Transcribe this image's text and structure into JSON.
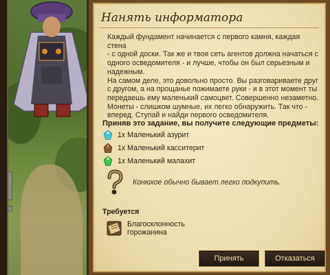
{
  "quest": {
    "title": "Нанять информатора",
    "description_lines": [
      "Каждый фундамент начинается с первого камня, каждая стена",
      "- с одной доски. Так же и твоя сеть агентов должна начаться с",
      "одного осведомителя - и лучше, чтобы он был серьезным и",
      "надежным.",
      "На самом деле, это довольно просто. Вы разговариваете друг",
      "с другом, а на прощанье пожимаете руки - и в этот момент ты",
      "передаешь ему маленький самоцвет. Совершенно незаметно.",
      "Монеты - слишком шумные, их легко обнаружить. Так что -",
      "вперед. Ступай и найди первого осведомителя."
    ],
    "rewards_heading": "Приняв это задание, вы получите следующие предметы:",
    "rewards": [
      {
        "text": "1x Маленький азурит",
        "icon": "azurite-gem-icon",
        "color": "#4fc6d8"
      },
      {
        "text": "1x Маленький касситерит",
        "icon": "cassiterite-gem-icon",
        "color": "#8a5a32"
      },
      {
        "text": "1x Маленький малахит",
        "icon": "malachite-gem-icon",
        "color": "#3ec64a"
      }
    ],
    "hint": "Конюхое обычно бывает легко подкупить.",
    "requires_heading": "Требуется",
    "requirement": {
      "line1": "Благосклонность",
      "line2": "горожанина",
      "icon": "scroll-icon"
    }
  },
  "buttons": {
    "accept": "Принять",
    "decline": "Отказаться"
  }
}
